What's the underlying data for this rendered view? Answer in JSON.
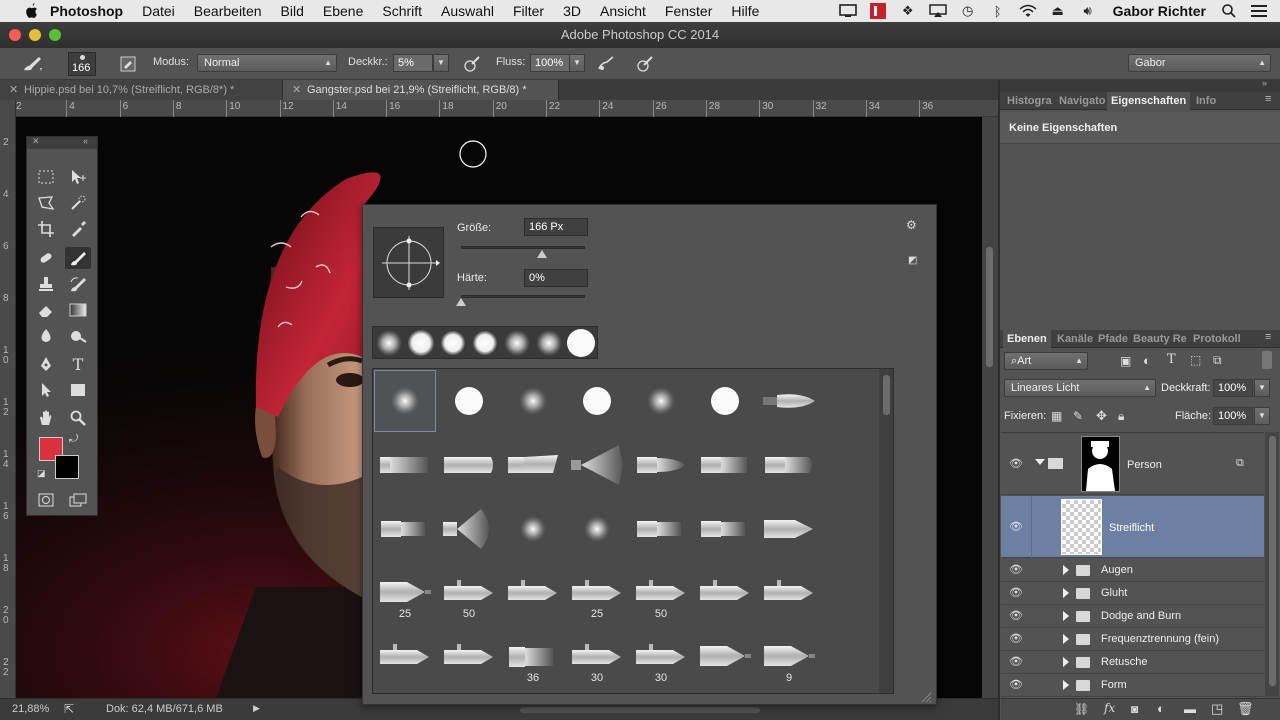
{
  "menubar": {
    "app_name": "Photoshop",
    "items": [
      "Datei",
      "Bearbeiten",
      "Bild",
      "Ebene",
      "Schrift",
      "Auswahl",
      "Filter",
      "3D",
      "Ansicht",
      "Fenster",
      "Hilfe"
    ],
    "user": "Gabor Richter"
  },
  "window": {
    "title": "Adobe Photoshop CC 2014"
  },
  "options": {
    "brush_size": "166",
    "mode_label": "Modus:",
    "mode_value": "Normal",
    "opacity_label": "Deckkr.:",
    "opacity_value": "5%",
    "flow_label": "Fluss:",
    "flow_value": "100%",
    "workspace": "Gabor"
  },
  "tabs": [
    {
      "label": "Hippie.psd bei 10,7% (Streiflicht, RGB/8*) *",
      "active": false
    },
    {
      "label": "Gangster.psd bei 21,9% (Streiflicht, RGB/8) *",
      "active": true
    }
  ],
  "ruler": {
    "h": [
      "2",
      "4",
      "6",
      "8",
      "10",
      "12",
      "14",
      "16",
      "18",
      "20",
      "22",
      "24",
      "26",
      "28",
      "30",
      "32",
      "34",
      "36"
    ],
    "v": [
      "2",
      "4",
      "6",
      "8",
      "1\n0",
      "1\n2",
      "1\n4",
      "1\n6",
      "1\n8",
      "2\n0",
      "2\n2"
    ]
  },
  "status": {
    "zoom": "21,88%",
    "doc": "Dok: 62,4 MB/671,6 MB"
  },
  "brush_picker": {
    "size_label": "Größe:",
    "size_value": "166 Px",
    "size_level": 0.65,
    "hardness_label": "Härte:",
    "hardness_value": "0%",
    "hardness_level": 0.0,
    "numbers": {
      "r4c0": "25",
      "r4c1": "50",
      "r4c3": "25",
      "r4c4": "50",
      "r5c2": "36",
      "r5c3": "30",
      "r5c4": "30",
      "r5c6": "9"
    }
  },
  "panels": {
    "top_tabs": [
      "Histogra",
      "Navigato",
      "Eigenschaften",
      "Info"
    ],
    "props_text": "Keine Eigenschaften",
    "layers_tabs": [
      "Ebenen",
      "Kanäle",
      "Pfade",
      "Beauty Re",
      "Protokoll"
    ],
    "filter_kind": "Art",
    "blend_mode": "Lineares Licht",
    "opacity_label": "Deckkraft:",
    "opacity_value": "100%",
    "lock_label": "Fixieren:",
    "fill_label": "Fläche:",
    "fill_value": "100%",
    "layers": [
      {
        "name": "Person",
        "type": "group-mask"
      },
      {
        "name": "Streiflicht",
        "type": "layer",
        "selected": true
      },
      {
        "name": "Augen",
        "type": "folder"
      },
      {
        "name": "Gluht",
        "type": "folder"
      },
      {
        "name": "Dodge and Burn",
        "type": "folder"
      },
      {
        "name": "Frequenztrennung (fein)",
        "type": "folder"
      },
      {
        "name": "Retusche",
        "type": "folder"
      },
      {
        "name": "Form",
        "type": "folder"
      }
    ]
  },
  "colors": {
    "foreground": "#d8323c",
    "background": "#000000",
    "selection": "#6d7fa3"
  }
}
